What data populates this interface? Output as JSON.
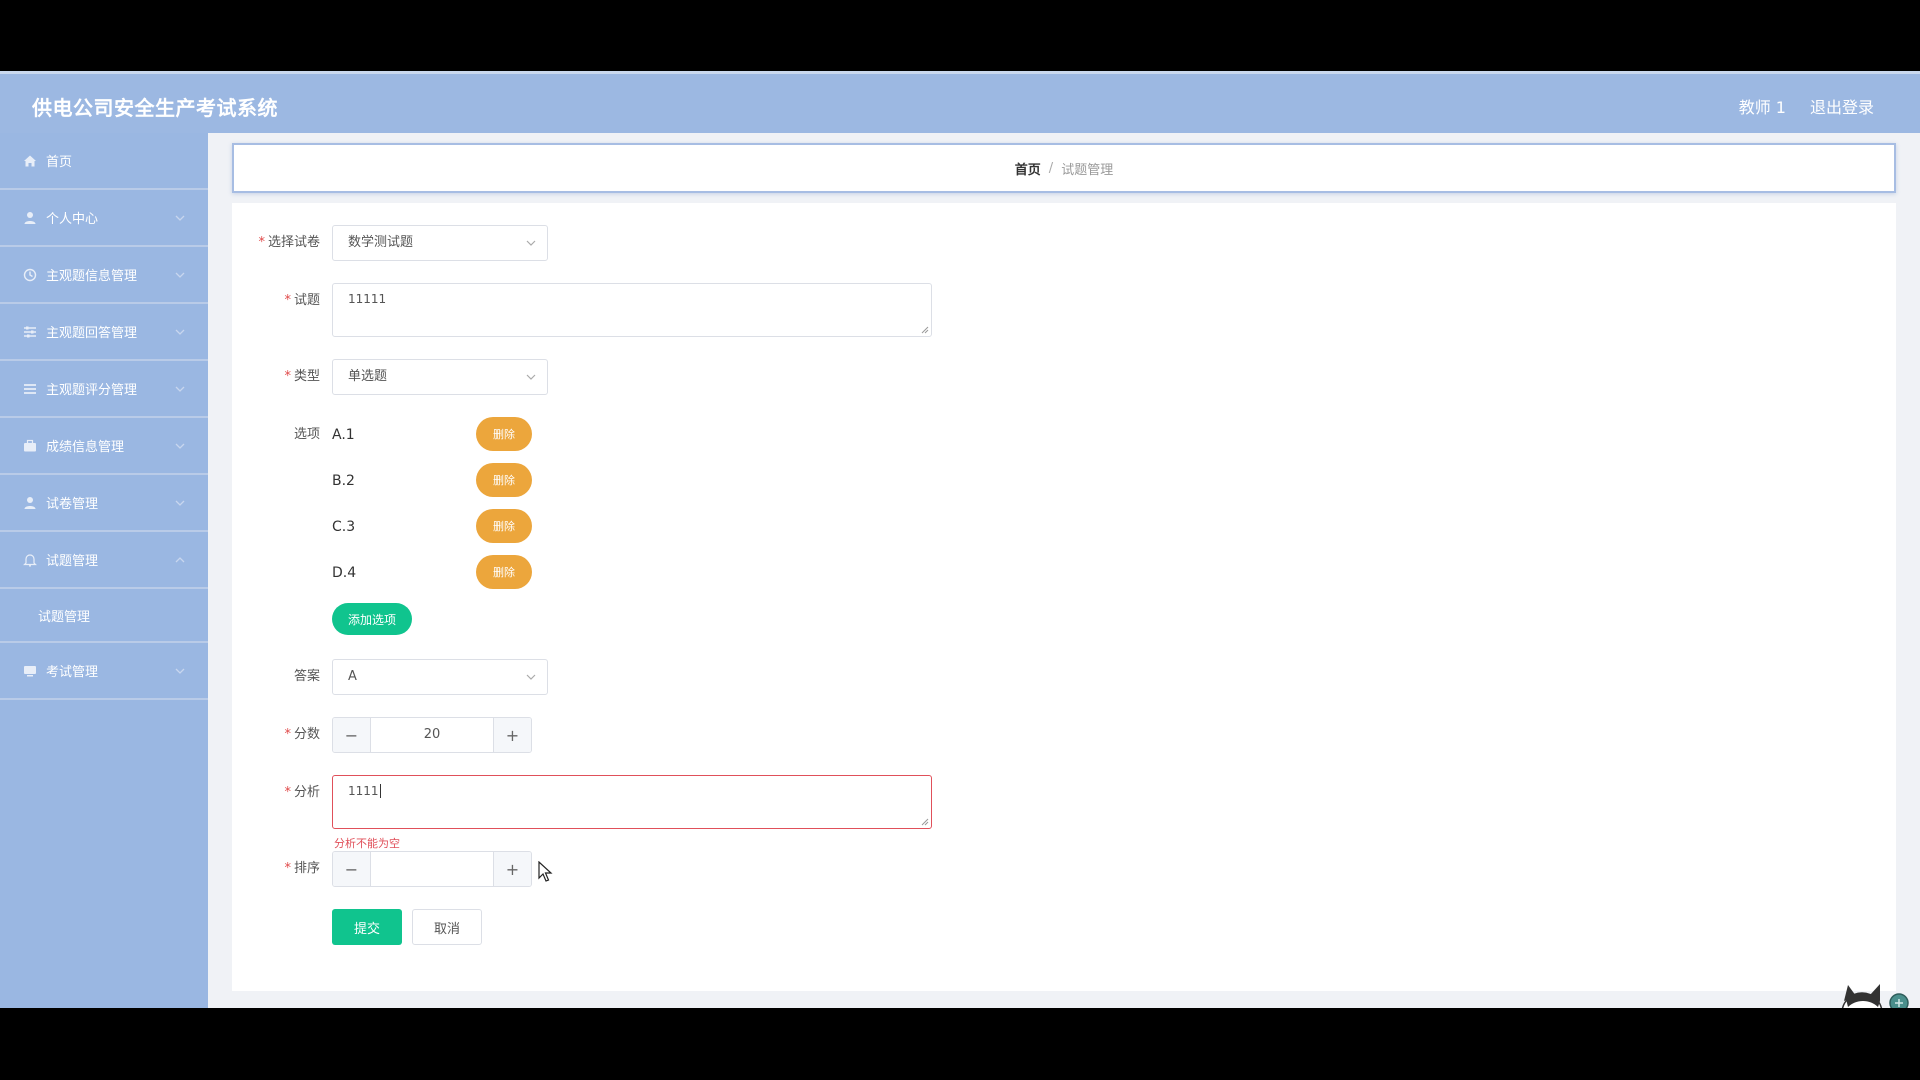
{
  "header": {
    "title": "供电公司安全生产考试系统",
    "user": "教师 1",
    "logout": "退出登录"
  },
  "sidebar": {
    "items": [
      {
        "label": "首页"
      },
      {
        "label": "个人中心"
      },
      {
        "label": "主观题信息管理"
      },
      {
        "label": "主观题回答管理"
      },
      {
        "label": "主观题评分管理"
      },
      {
        "label": "成绩信息管理"
      },
      {
        "label": "试卷管理"
      },
      {
        "label": "试题管理"
      }
    ],
    "subitem": "试题管理",
    "last_item": "考试管理"
  },
  "breadcrumb": {
    "home": "首页",
    "separator": "/",
    "current": "试题管理"
  },
  "form": {
    "paper_label": "选择试卷",
    "paper_value": "数学测试题",
    "question_label": "试题",
    "question_value": "11111",
    "type_label": "类型",
    "type_value": "单选题",
    "options_label": "选项",
    "options": [
      {
        "text": "A.1",
        "delete": "删除"
      },
      {
        "text": "B.2",
        "delete": "删除"
      },
      {
        "text": "C.3",
        "delete": "删除"
      },
      {
        "text": "D.4",
        "delete": "删除"
      }
    ],
    "add_option": "添加选项",
    "answer_label": "答案",
    "answer_value": "A",
    "score_label": "分数",
    "score_value": "20",
    "analysis_label": "分析",
    "analysis_value": "1111",
    "analysis_error": "分析不能为空",
    "order_label": "排序",
    "order_value": "",
    "submit": "提交",
    "cancel": "取消"
  },
  "colors": {
    "header": "#9cb8e2",
    "sidebar": "#9ab7e2",
    "primary": "#10c48e",
    "warning": "#eca63c",
    "error": "#e0505a"
  }
}
